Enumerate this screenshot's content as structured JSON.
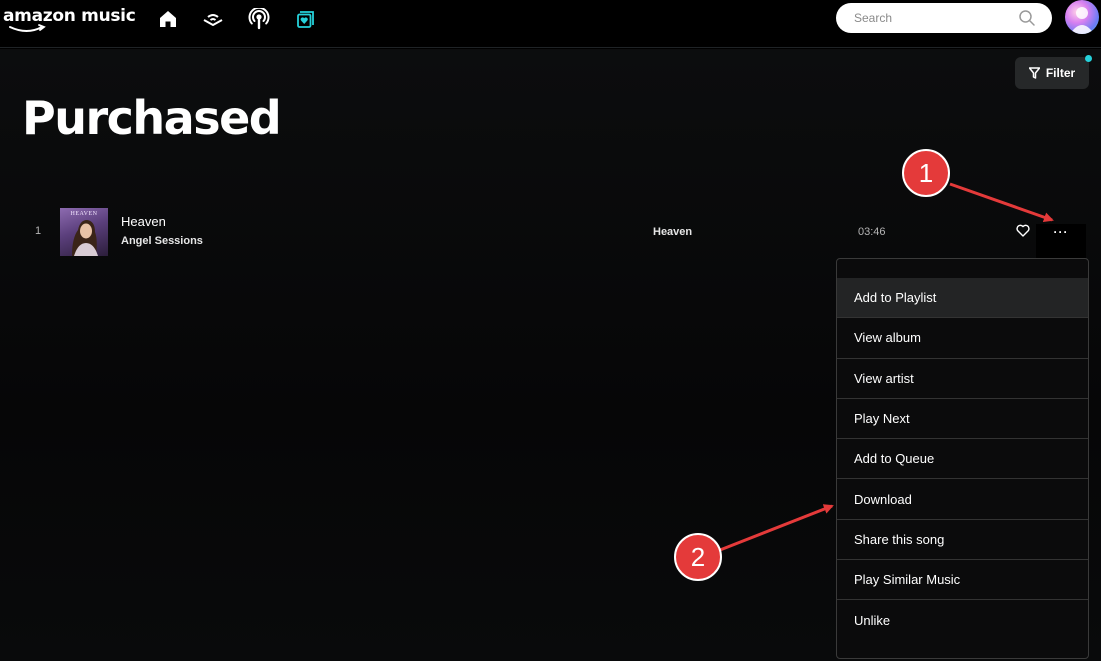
{
  "app": {
    "logo_text": "amazon music"
  },
  "nav": {
    "icons": [
      "home-icon",
      "audible-icon",
      "podcast-icon",
      "library-icon"
    ],
    "active_color": "#25d1da"
  },
  "search": {
    "placeholder": "Search"
  },
  "filter": {
    "label": "Filter"
  },
  "page": {
    "title": "Purchased"
  },
  "tracks": [
    {
      "index": "1",
      "title": "Heaven",
      "artist": "Angel Sessions",
      "album": "Heaven",
      "duration": "03:46",
      "cover_text": "HEAVEN"
    }
  ],
  "context_menu": {
    "items": [
      "Add to Playlist",
      "View album",
      "View artist",
      "Play Next",
      "Add to Queue",
      "Download",
      "Share this song",
      "Play Similar Music",
      "Unlike"
    ]
  },
  "annotations": {
    "badge1": "1",
    "badge2": "2",
    "color": "#e43a3a"
  }
}
